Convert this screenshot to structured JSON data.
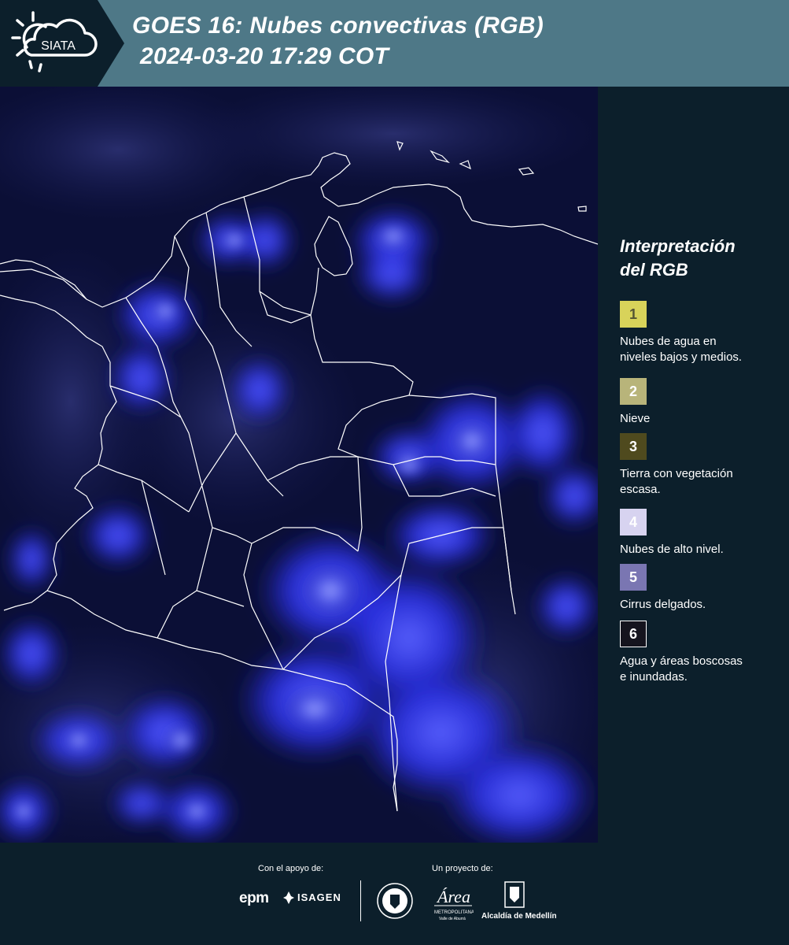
{
  "header": {
    "logo_text": "SIATA",
    "title_line1": "GOES 16: Nubes convectivas (RGB)",
    "title_line2": "2024-03-20 17:29 COT"
  },
  "legend": {
    "title_line1": "Interpretación",
    "title_line2": "del RGB",
    "items": [
      {
        "number": "1",
        "color": "#d8d35a",
        "text_color": "#555533",
        "label_line1": "Nubes de agua en",
        "label_line2": "niveles bajos y medios."
      },
      {
        "number": "2",
        "color": "#b8b47a",
        "text_color": "#ffffff",
        "label_line1": "Nieve",
        "label_line2": ""
      },
      {
        "number": "3",
        "color": "#4f4a1e",
        "text_color": "#ffffff",
        "label_line1": "Tierra con vegetación",
        "label_line2": "escasa."
      },
      {
        "number": "4",
        "color": "#d7d3f0",
        "text_color": "#ffffff",
        "label_line1": "Nubes de alto nivel.",
        "label_line2": ""
      },
      {
        "number": "5",
        "color": "#7a76b2",
        "text_color": "#ffffff",
        "label_line1": "Cirrus delgados.",
        "label_line2": ""
      },
      {
        "number": "6",
        "color": "#15141e",
        "text_color": "#ffffff",
        "label_line1": "Agua y áreas boscosas",
        "label_line2": "e inundadas."
      }
    ]
  },
  "footer": {
    "support_label": "Con el apoyo de:",
    "project_label": "Un proyecto de:",
    "epm": "epm",
    "isagen": "ISAGEN",
    "area_logo": "Área Metropolitana Valle de Aburrá",
    "alcaldia": "Alcaldía de Medellín"
  }
}
